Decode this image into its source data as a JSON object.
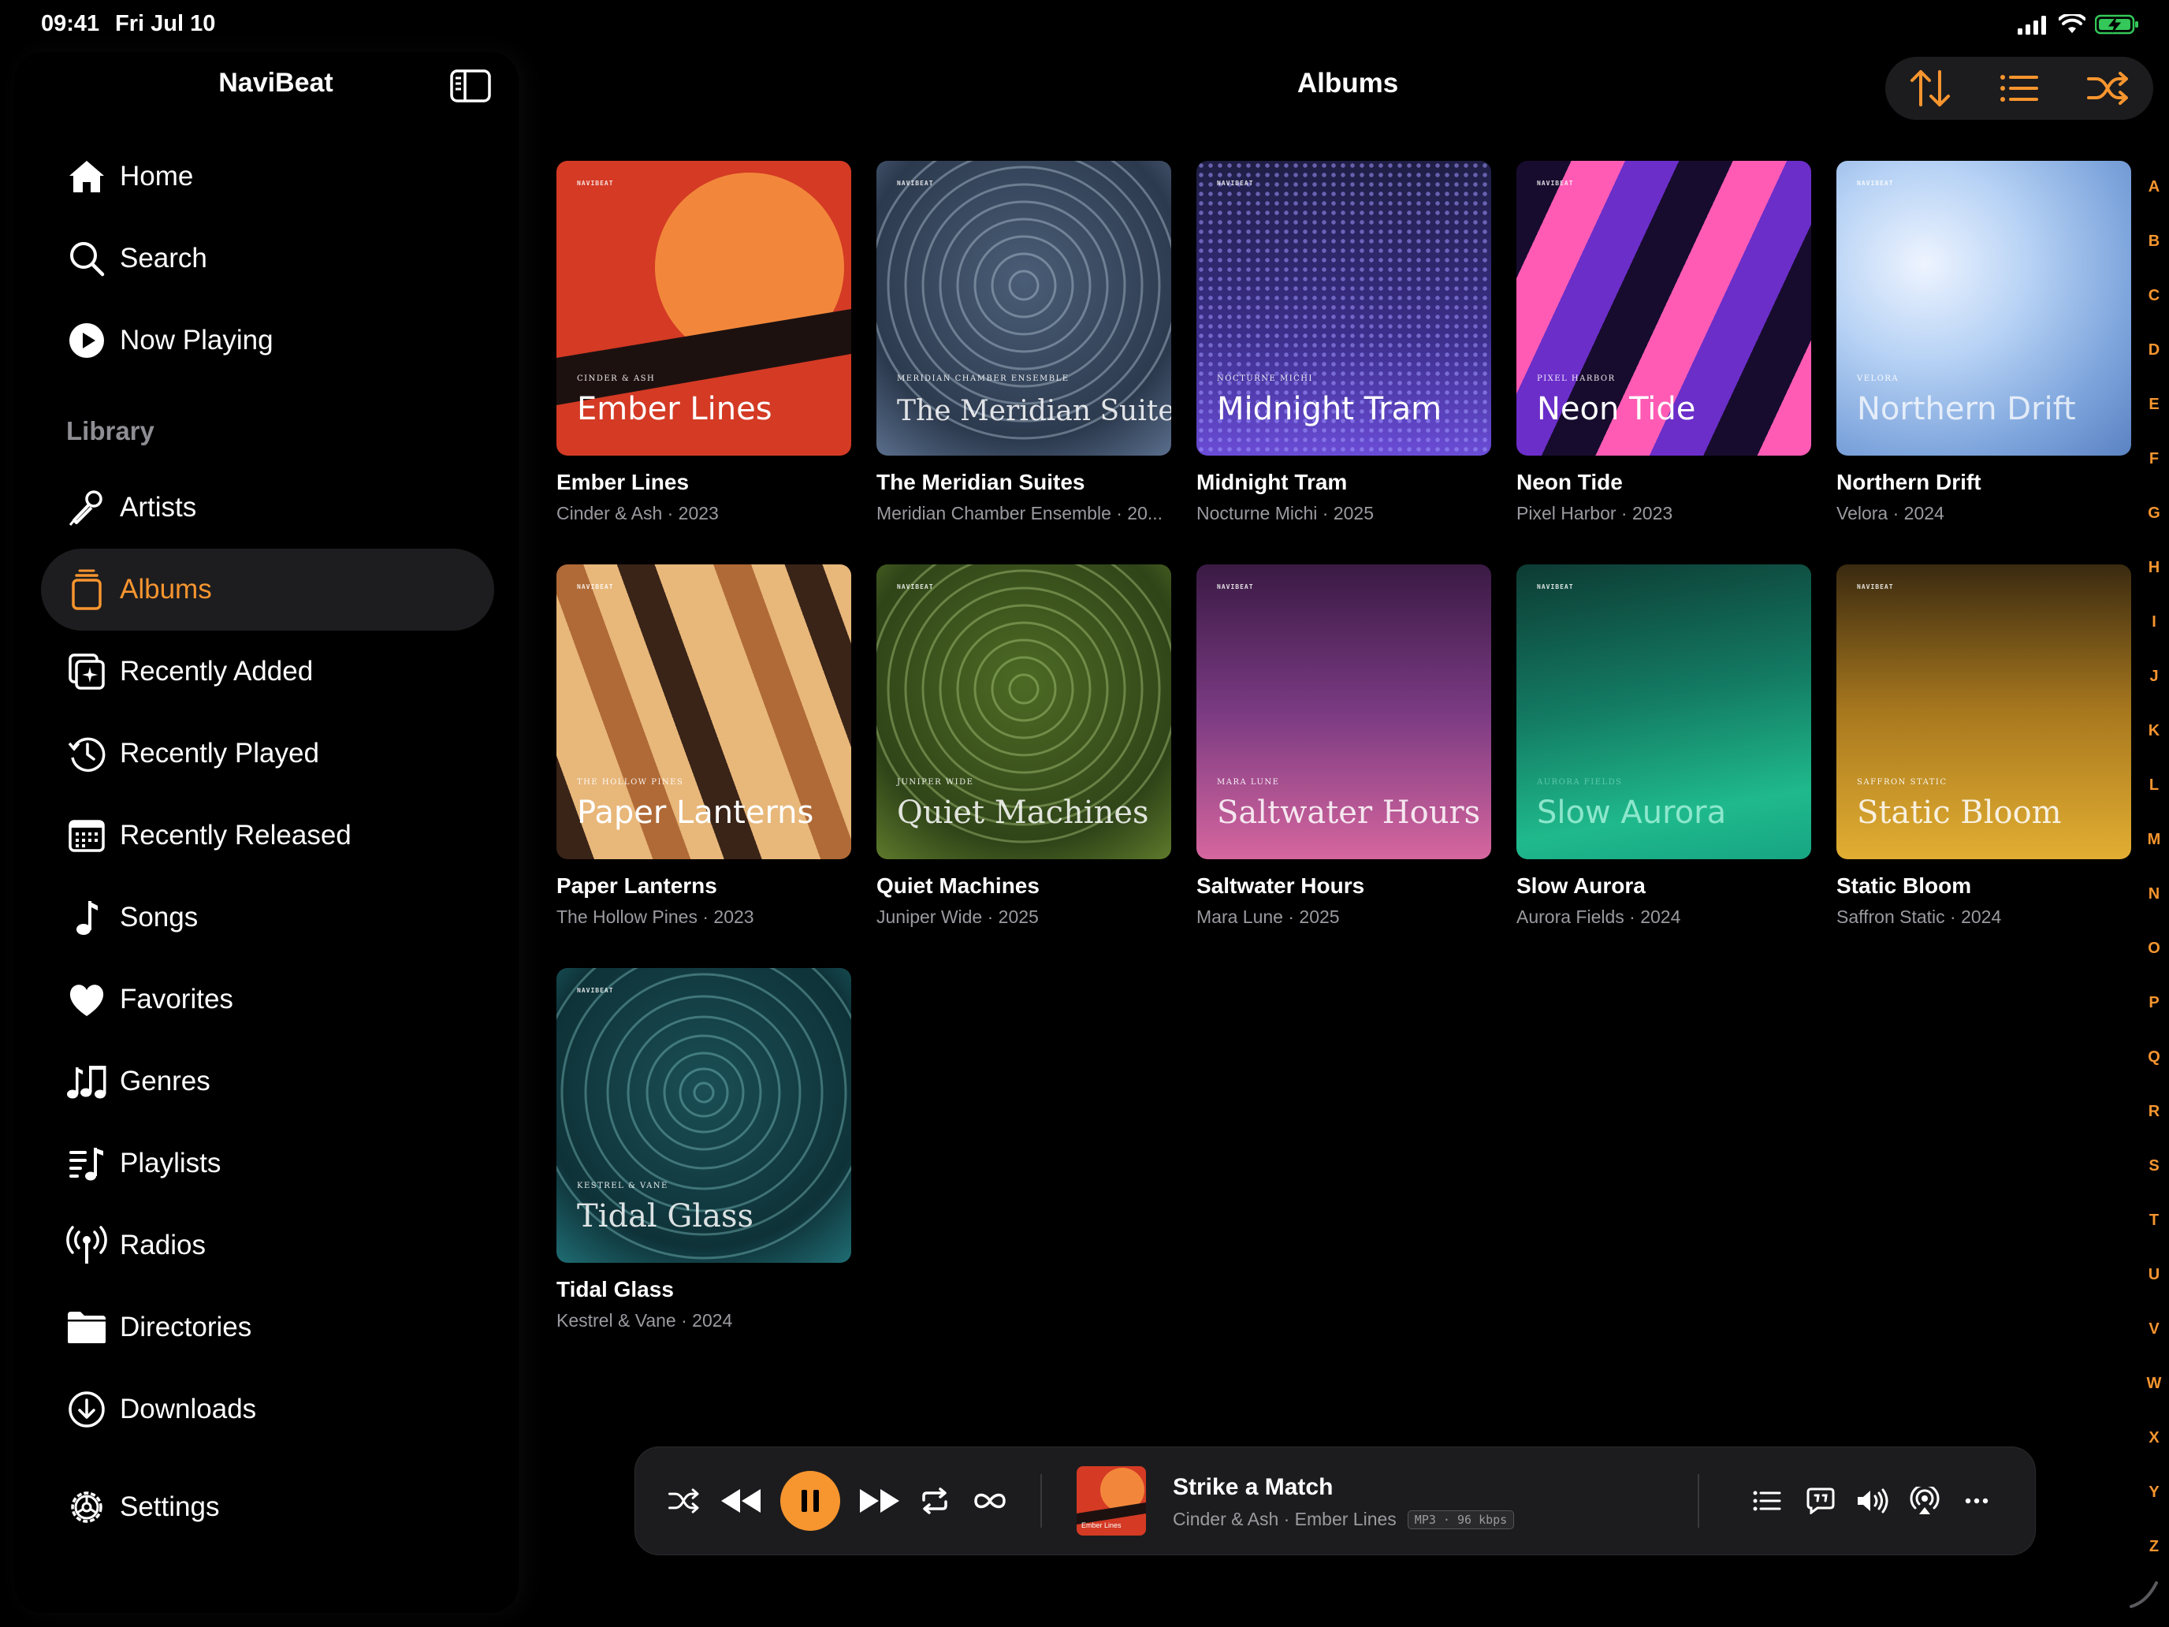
{
  "status": {
    "time": "09:41",
    "date": "Fri Jul 10"
  },
  "app_title": "NaviBeat",
  "page_title": "Albums",
  "sidebar": {
    "library_heading": "Library",
    "items": [
      {
        "label": "Home",
        "icon": "house-icon"
      },
      {
        "label": "Search",
        "icon": "search-icon"
      },
      {
        "label": "Now Playing",
        "icon": "play-circle-icon"
      },
      {
        "label": "Artists",
        "icon": "microphone-icon"
      },
      {
        "label": "Albums",
        "icon": "album-stack-icon",
        "active": true
      },
      {
        "label": "Recently Added",
        "icon": "sparkle-plus-icon"
      },
      {
        "label": "Recently Played",
        "icon": "clock-history-icon"
      },
      {
        "label": "Recently Released",
        "icon": "calendar-icon"
      },
      {
        "label": "Songs",
        "icon": "music-note-icon"
      },
      {
        "label": "Favorites",
        "icon": "heart-icon"
      },
      {
        "label": "Genres",
        "icon": "music-notes-icon"
      },
      {
        "label": "Playlists",
        "icon": "playlist-icon"
      },
      {
        "label": "Radios",
        "icon": "antenna-icon"
      },
      {
        "label": "Directories",
        "icon": "folder-icon"
      },
      {
        "label": "Downloads",
        "icon": "download-circle-icon"
      },
      {
        "label": "Settings",
        "icon": "gear-icon"
      }
    ]
  },
  "colors": {
    "accent": "#f7952f",
    "background": "#000000",
    "panel": "#1c1c1e"
  },
  "albums": [
    {
      "title": "Ember Lines",
      "subtitle": "Cinder & Ash · 2023",
      "cover_title": "Ember Lines",
      "cover_artist": "Cinder & Ash",
      "cover_brand": "NAVIBEAT"
    },
    {
      "title": "The Meridian Suites",
      "subtitle": "Meridian Chamber Ensemble · 20...",
      "cover_title": "The Meridian Suites",
      "cover_artist": "Meridian Chamber Ensemble",
      "cover_brand": "NAVIBEAT"
    },
    {
      "title": "Midnight Tram",
      "subtitle": "Nocturne Michi · 2025",
      "cover_title": "Midnight Tram",
      "cover_artist": "Nocturne Michi",
      "cover_brand": "NAVIBEAT"
    },
    {
      "title": "Neon Tide",
      "subtitle": "Pixel Harbor · 2023",
      "cover_title": "Neon Tide",
      "cover_artist": "Pixel Harbor",
      "cover_brand": "NAVIBEAT"
    },
    {
      "title": "Northern Drift",
      "subtitle": "Velora · 2024",
      "cover_title": "Northern Drift",
      "cover_artist": "Velora",
      "cover_brand": "NAVIBEAT"
    },
    {
      "title": "Paper Lanterns",
      "subtitle": "The Hollow Pines · 2023",
      "cover_title": "Paper Lanterns",
      "cover_artist": "The Hollow Pines",
      "cover_brand": "NAVIBEAT"
    },
    {
      "title": "Quiet Machines",
      "subtitle": "Juniper Wide · 2025",
      "cover_title": "Quiet Machines",
      "cover_artist": "Juniper Wide",
      "cover_brand": "NAVIBEAT"
    },
    {
      "title": "Saltwater Hours",
      "subtitle": "Mara Lune · 2025",
      "cover_title": "Saltwater Hours",
      "cover_artist": "Mara Lune",
      "cover_brand": "NAVIBEAT"
    },
    {
      "title": "Slow Aurora",
      "subtitle": "Aurora Fields · 2024",
      "cover_title": "Slow Aurora",
      "cover_artist": "Aurora Fields",
      "cover_brand": "NAVIBEAT"
    },
    {
      "title": "Static Bloom",
      "subtitle": "Saffron Static · 2024",
      "cover_title": "Static Bloom",
      "cover_artist": "Saffron Static",
      "cover_brand": "NAVIBEAT"
    },
    {
      "title": "Tidal Glass",
      "subtitle": "Kestrel & Vane · 2024",
      "cover_title": "Tidal Glass",
      "cover_artist": "Kestrel & Vane",
      "cover_brand": "NAVIBEAT"
    }
  ],
  "alphabet": [
    "A",
    "B",
    "C",
    "D",
    "E",
    "F",
    "G",
    "H",
    "I",
    "J",
    "K",
    "L",
    "M",
    "N",
    "O",
    "P",
    "Q",
    "R",
    "S",
    "T",
    "U",
    "V",
    "W",
    "X",
    "Y",
    "Z"
  ],
  "now_playing": {
    "title": "Strike a Match",
    "subtitle": "Cinder & Ash · Ember Lines",
    "format_badge": "MP3 · 96 kbps",
    "art_label": "Ember Lines"
  }
}
